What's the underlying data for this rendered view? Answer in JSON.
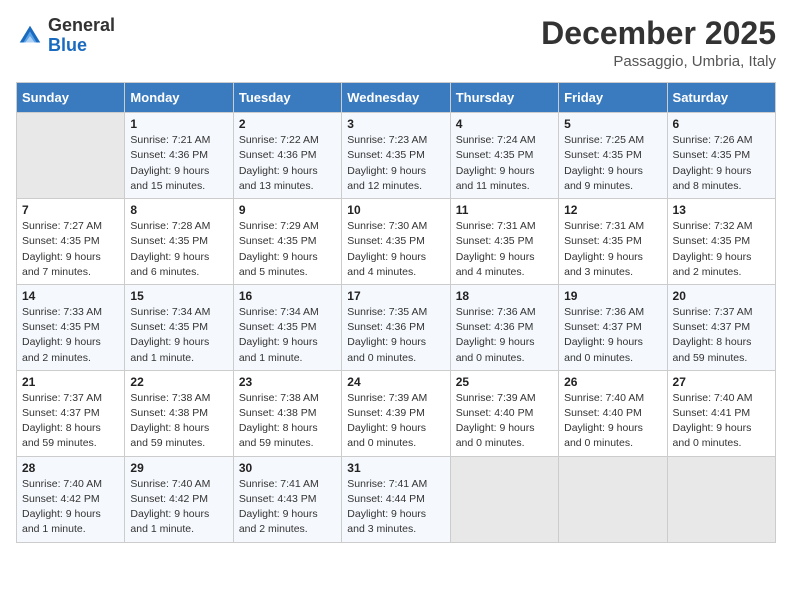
{
  "header": {
    "logo_general": "General",
    "logo_blue": "Blue",
    "month_title": "December 2025",
    "location": "Passaggio, Umbria, Italy"
  },
  "days_of_week": [
    "Sunday",
    "Monday",
    "Tuesday",
    "Wednesday",
    "Thursday",
    "Friday",
    "Saturday"
  ],
  "weeks": [
    [
      {
        "day": "",
        "info": ""
      },
      {
        "day": "1",
        "info": "Sunrise: 7:21 AM\nSunset: 4:36 PM\nDaylight: 9 hours\nand 15 minutes."
      },
      {
        "day": "2",
        "info": "Sunrise: 7:22 AM\nSunset: 4:36 PM\nDaylight: 9 hours\nand 13 minutes."
      },
      {
        "day": "3",
        "info": "Sunrise: 7:23 AM\nSunset: 4:35 PM\nDaylight: 9 hours\nand 12 minutes."
      },
      {
        "day": "4",
        "info": "Sunrise: 7:24 AM\nSunset: 4:35 PM\nDaylight: 9 hours\nand 11 minutes."
      },
      {
        "day": "5",
        "info": "Sunrise: 7:25 AM\nSunset: 4:35 PM\nDaylight: 9 hours\nand 9 minutes."
      },
      {
        "day": "6",
        "info": "Sunrise: 7:26 AM\nSunset: 4:35 PM\nDaylight: 9 hours\nand 8 minutes."
      }
    ],
    [
      {
        "day": "7",
        "info": "Sunrise: 7:27 AM\nSunset: 4:35 PM\nDaylight: 9 hours\nand 7 minutes."
      },
      {
        "day": "8",
        "info": "Sunrise: 7:28 AM\nSunset: 4:35 PM\nDaylight: 9 hours\nand 6 minutes."
      },
      {
        "day": "9",
        "info": "Sunrise: 7:29 AM\nSunset: 4:35 PM\nDaylight: 9 hours\nand 5 minutes."
      },
      {
        "day": "10",
        "info": "Sunrise: 7:30 AM\nSunset: 4:35 PM\nDaylight: 9 hours\nand 4 minutes."
      },
      {
        "day": "11",
        "info": "Sunrise: 7:31 AM\nSunset: 4:35 PM\nDaylight: 9 hours\nand 4 minutes."
      },
      {
        "day": "12",
        "info": "Sunrise: 7:31 AM\nSunset: 4:35 PM\nDaylight: 9 hours\nand 3 minutes."
      },
      {
        "day": "13",
        "info": "Sunrise: 7:32 AM\nSunset: 4:35 PM\nDaylight: 9 hours\nand 2 minutes."
      }
    ],
    [
      {
        "day": "14",
        "info": "Sunrise: 7:33 AM\nSunset: 4:35 PM\nDaylight: 9 hours\nand 2 minutes."
      },
      {
        "day": "15",
        "info": "Sunrise: 7:34 AM\nSunset: 4:35 PM\nDaylight: 9 hours\nand 1 minute."
      },
      {
        "day": "16",
        "info": "Sunrise: 7:34 AM\nSunset: 4:35 PM\nDaylight: 9 hours\nand 1 minute."
      },
      {
        "day": "17",
        "info": "Sunrise: 7:35 AM\nSunset: 4:36 PM\nDaylight: 9 hours\nand 0 minutes."
      },
      {
        "day": "18",
        "info": "Sunrise: 7:36 AM\nSunset: 4:36 PM\nDaylight: 9 hours\nand 0 minutes."
      },
      {
        "day": "19",
        "info": "Sunrise: 7:36 AM\nSunset: 4:37 PM\nDaylight: 9 hours\nand 0 minutes."
      },
      {
        "day": "20",
        "info": "Sunrise: 7:37 AM\nSunset: 4:37 PM\nDaylight: 8 hours\nand 59 minutes."
      }
    ],
    [
      {
        "day": "21",
        "info": "Sunrise: 7:37 AM\nSunset: 4:37 PM\nDaylight: 8 hours\nand 59 minutes."
      },
      {
        "day": "22",
        "info": "Sunrise: 7:38 AM\nSunset: 4:38 PM\nDaylight: 8 hours\nand 59 minutes."
      },
      {
        "day": "23",
        "info": "Sunrise: 7:38 AM\nSunset: 4:38 PM\nDaylight: 8 hours\nand 59 minutes."
      },
      {
        "day": "24",
        "info": "Sunrise: 7:39 AM\nSunset: 4:39 PM\nDaylight: 9 hours\nand 0 minutes."
      },
      {
        "day": "25",
        "info": "Sunrise: 7:39 AM\nSunset: 4:40 PM\nDaylight: 9 hours\nand 0 minutes."
      },
      {
        "day": "26",
        "info": "Sunrise: 7:40 AM\nSunset: 4:40 PM\nDaylight: 9 hours\nand 0 minutes."
      },
      {
        "day": "27",
        "info": "Sunrise: 7:40 AM\nSunset: 4:41 PM\nDaylight: 9 hours\nand 0 minutes."
      }
    ],
    [
      {
        "day": "28",
        "info": "Sunrise: 7:40 AM\nSunset: 4:42 PM\nDaylight: 9 hours\nand 1 minute."
      },
      {
        "day": "29",
        "info": "Sunrise: 7:40 AM\nSunset: 4:42 PM\nDaylight: 9 hours\nand 1 minute."
      },
      {
        "day": "30",
        "info": "Sunrise: 7:41 AM\nSunset: 4:43 PM\nDaylight: 9 hours\nand 2 minutes."
      },
      {
        "day": "31",
        "info": "Sunrise: 7:41 AM\nSunset: 4:44 PM\nDaylight: 9 hours\nand 3 minutes."
      },
      {
        "day": "",
        "info": ""
      },
      {
        "day": "",
        "info": ""
      },
      {
        "day": "",
        "info": ""
      }
    ]
  ]
}
